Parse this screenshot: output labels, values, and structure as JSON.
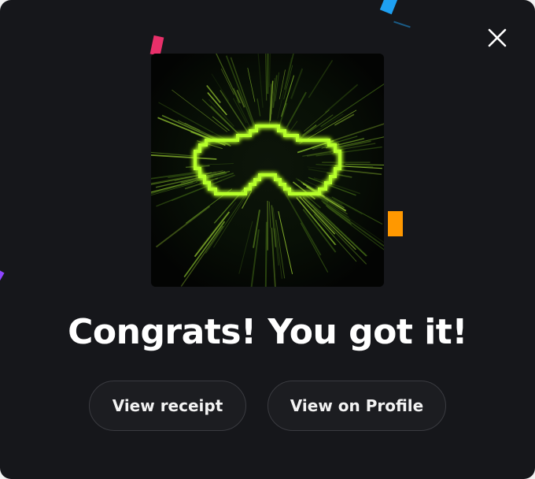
{
  "modal": {
    "headline": "Congrats! You got it!",
    "close_icon": "close-icon",
    "artwork": {
      "icon": "neon-pixel-goggles",
      "glow_color": "#b6ff2a",
      "background": "#050705"
    },
    "actions": {
      "view_receipt_label": "View receipt",
      "view_profile_label": "View on Profile"
    },
    "confetti_colors": [
      "#e8306a",
      "#1ea0f2",
      "#ff9800",
      "#8e44ff"
    ]
  }
}
